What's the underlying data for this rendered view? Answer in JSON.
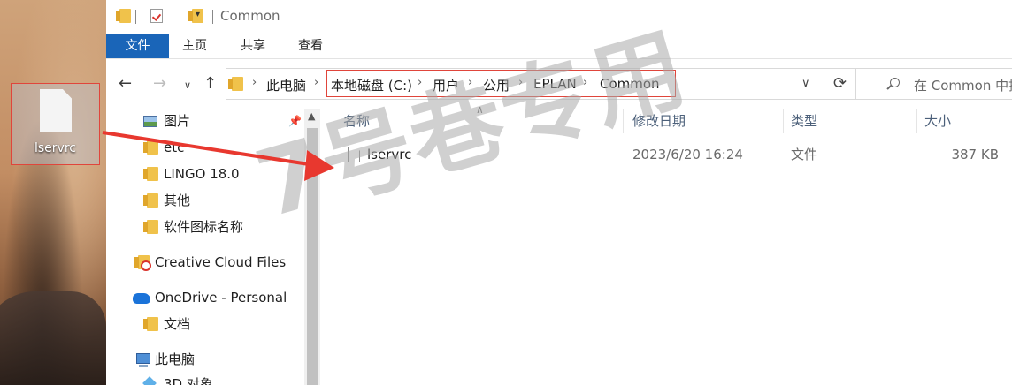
{
  "desktop": {
    "file_label": "lservrc"
  },
  "titlebar": {
    "title": "Common",
    "dropdown_glyph": "▾"
  },
  "ribbon": {
    "tabs": {
      "file": "文件",
      "home": "主页",
      "share": "共享",
      "view": "查看"
    }
  },
  "address": {
    "crumbs": [
      "此电脑",
      "本地磁盘 (C:)",
      "用户",
      "公用",
      "EPLAN",
      "Common"
    ],
    "chevron": "›"
  },
  "search": {
    "placeholder": "在 Common 中搜"
  },
  "nav": {
    "items": [
      "图片",
      "etc",
      "LINGO 18.0",
      "其他",
      "软件图标名称",
      "Creative Cloud Files",
      "OneDrive - Personal",
      "文档",
      "此电脑",
      "3D 对象"
    ]
  },
  "columns": {
    "name": "名称",
    "date": "修改日期",
    "type": "类型",
    "size": "大小"
  },
  "files": [
    {
      "name": "lservrc",
      "date": "2023/6/20 16:24",
      "type": "文件",
      "size": "387 KB"
    }
  ],
  "watermark": "7号巷专用",
  "colors": {
    "accent": "#1a65b8",
    "highlight_box": "#e0453b",
    "arrow": "#e8382f"
  },
  "icons": [
    "folder-icon",
    "checkbox-icon",
    "back-icon",
    "forward-icon",
    "up-icon",
    "refresh-icon",
    "search-icon",
    "pin-icon",
    "file-icon"
  ]
}
